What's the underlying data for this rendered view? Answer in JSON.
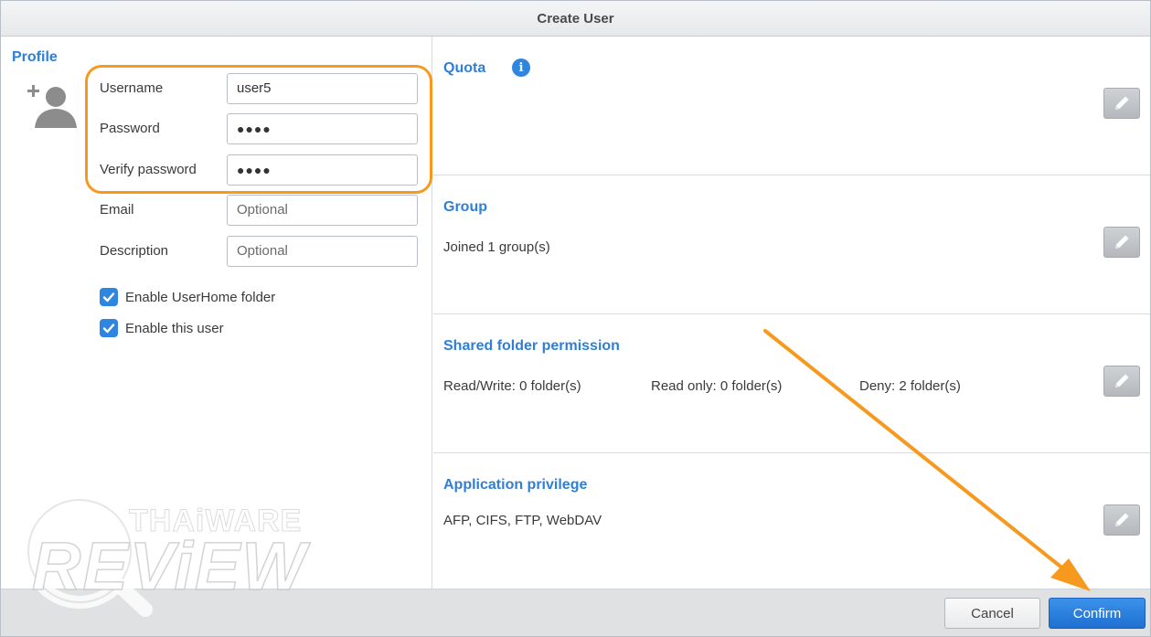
{
  "window": {
    "title": "Create User"
  },
  "profile": {
    "title": "Profile",
    "fields": {
      "username": {
        "label": "Username",
        "value": "user5"
      },
      "password": {
        "label": "Password",
        "value": "●●●●"
      },
      "verify": {
        "label": "Verify password",
        "value": "●●●●"
      },
      "email": {
        "label": "Email",
        "placeholder": "Optional"
      },
      "description": {
        "label": "Description",
        "placeholder": "Optional"
      }
    },
    "checks": {
      "userhome": {
        "label": "Enable UserHome folder",
        "checked": true
      },
      "enable_user": {
        "label": "Enable this user",
        "checked": true
      }
    }
  },
  "sections": {
    "quota": {
      "title": "Quota"
    },
    "group": {
      "title": "Group",
      "text": "Joined 1 group(s)"
    },
    "shared": {
      "title": "Shared folder permission",
      "read_write": "Read/Write: 0 folder(s)",
      "read_only": "Read only: 0 folder(s)",
      "deny": "Deny: 2 folder(s)"
    },
    "app": {
      "title": "Application privilege",
      "text": "AFP, CIFS, FTP, WebDAV"
    }
  },
  "footer": {
    "cancel_label": "Cancel",
    "confirm_label": "Confirm"
  },
  "watermark": {
    "line1": "THAiWARE",
    "line2": "REViEW"
  },
  "colors": {
    "accent_blue": "#2f7fd6",
    "highlight_orange": "#f6991e",
    "confirm_blue": "#1f6fd1"
  }
}
